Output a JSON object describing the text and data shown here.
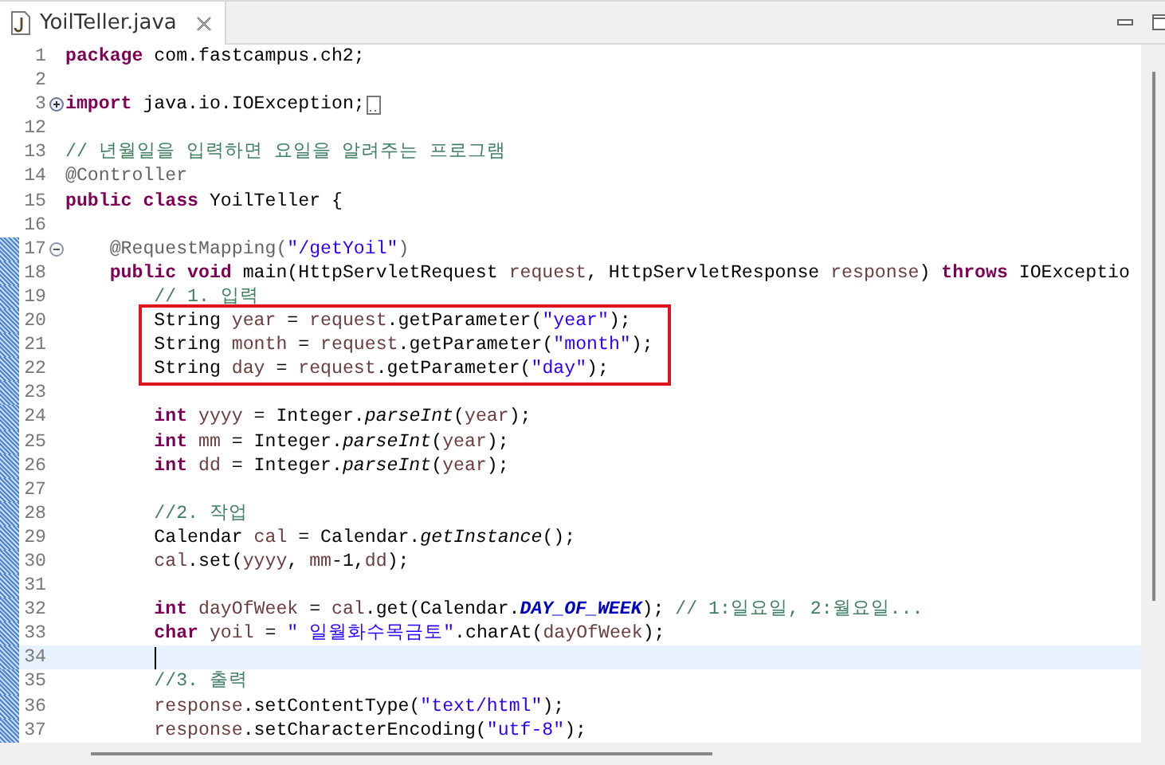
{
  "tab": {
    "title": "YoilTeller.java",
    "selected": true
  },
  "lines": [
    {
      "number": "1",
      "tokens": [
        {
          "kind": "keyword",
          "text": "package"
        },
        {
          "kind": "plain",
          "text": " com.fastcampus.ch2;"
        }
      ]
    },
    {
      "number": "2"
    },
    {
      "number": "3",
      "folded": true,
      "tokens": [
        {
          "kind": "keyword",
          "text": "import"
        },
        {
          "kind": "plain",
          "text": " java.io.IOException;"
        }
      ]
    },
    {
      "number": "12"
    },
    {
      "number": "13",
      "tokens": [
        {
          "kind": "comment",
          "text": "// 년월일을 입력하면 요일을 알려주는 프로그램"
        }
      ]
    },
    {
      "number": "14",
      "tokens": [
        {
          "kind": "annotation",
          "text": "@Controller"
        }
      ]
    },
    {
      "number": "15",
      "tokens": [
        {
          "kind": "keyword",
          "text": "public"
        },
        {
          "kind": "keyword",
          "text": " class"
        },
        {
          "kind": "plain",
          "text": " YoilTeller {"
        }
      ]
    },
    {
      "number": "16"
    },
    {
      "number": "17",
      "folded": false,
      "range": true,
      "tokens": [
        {
          "kind": "annotation",
          "text": "    @RequestMapping("
        },
        {
          "kind": "string",
          "text": "\"/getYoil\""
        },
        {
          "kind": "annotation",
          "text": ")"
        }
      ]
    },
    {
      "number": "18",
      "range": true,
      "tokens": [
        {
          "kind": "keyword",
          "text": "    public"
        },
        {
          "kind": "keyword",
          "text": " void"
        },
        {
          "kind": "plain",
          "text": " main(HttpServletRequest "
        },
        {
          "kind": "variable",
          "text": "request"
        },
        {
          "kind": "plain",
          "text": ", HttpServletResponse "
        },
        {
          "kind": "variable",
          "text": "response"
        },
        {
          "kind": "plain",
          "text": ") "
        },
        {
          "kind": "keyword",
          "text": "throws"
        },
        {
          "kind": "plain",
          "text": " IOExceptio"
        }
      ]
    },
    {
      "number": "19",
      "range": true,
      "tokens": [
        {
          "kind": "comment",
          "text": "        // 1. 입력"
        }
      ]
    },
    {
      "number": "20",
      "range": true,
      "boxed": true,
      "tokens": [
        {
          "kind": "plain",
          "text": "        String "
        },
        {
          "kind": "variable",
          "text": "year"
        },
        {
          "kind": "plain",
          "text": " = "
        },
        {
          "kind": "variable",
          "text": "request"
        },
        {
          "kind": "plain",
          "text": ".getParameter("
        },
        {
          "kind": "string",
          "text": "\"year\""
        },
        {
          "kind": "plain",
          "text": ");"
        }
      ]
    },
    {
      "number": "21",
      "range": true,
      "boxed": true,
      "tokens": [
        {
          "kind": "plain",
          "text": "        String "
        },
        {
          "kind": "variable",
          "text": "month"
        },
        {
          "kind": "plain",
          "text": " = "
        },
        {
          "kind": "variable",
          "text": "request"
        },
        {
          "kind": "plain",
          "text": ".getParameter("
        },
        {
          "kind": "string",
          "text": "\"month\""
        },
        {
          "kind": "plain",
          "text": ");"
        }
      ]
    },
    {
      "number": "22",
      "range": true,
      "boxed": true,
      "tokens": [
        {
          "kind": "plain",
          "text": "        String "
        },
        {
          "kind": "variable",
          "text": "day"
        },
        {
          "kind": "plain",
          "text": " = "
        },
        {
          "kind": "variable",
          "text": "request"
        },
        {
          "kind": "plain",
          "text": ".getParameter("
        },
        {
          "kind": "string",
          "text": "\"day\""
        },
        {
          "kind": "plain",
          "text": ");"
        }
      ]
    },
    {
      "number": "23",
      "range": true
    },
    {
      "number": "24",
      "range": true,
      "tokens": [
        {
          "kind": "keyword",
          "text": "        int"
        },
        {
          "kind": "variable",
          "text": " yyyy"
        },
        {
          "kind": "plain",
          "text": " = Integer."
        },
        {
          "kind": "static",
          "text": "parseInt"
        },
        {
          "kind": "plain",
          "text": "("
        },
        {
          "kind": "variable",
          "text": "year"
        },
        {
          "kind": "plain",
          "text": ");"
        }
      ]
    },
    {
      "number": "25",
      "range": true,
      "tokens": [
        {
          "kind": "keyword",
          "text": "        int"
        },
        {
          "kind": "variable",
          "text": " mm"
        },
        {
          "kind": "plain",
          "text": " = Integer."
        },
        {
          "kind": "static",
          "text": "parseInt"
        },
        {
          "kind": "plain",
          "text": "("
        },
        {
          "kind": "variable",
          "text": "year"
        },
        {
          "kind": "plain",
          "text": ");"
        }
      ]
    },
    {
      "number": "26",
      "range": true,
      "tokens": [
        {
          "kind": "keyword",
          "text": "        int"
        },
        {
          "kind": "variable",
          "text": " dd"
        },
        {
          "kind": "plain",
          "text": " = Integer."
        },
        {
          "kind": "static",
          "text": "parseInt"
        },
        {
          "kind": "plain",
          "text": "("
        },
        {
          "kind": "variable",
          "text": "year"
        },
        {
          "kind": "plain",
          "text": ");"
        }
      ]
    },
    {
      "number": "27",
      "range": true
    },
    {
      "number": "28",
      "range": true,
      "tokens": [
        {
          "kind": "comment",
          "text": "        //2. 작업"
        }
      ]
    },
    {
      "number": "29",
      "range": true,
      "tokens": [
        {
          "kind": "plain",
          "text": "        Calendar "
        },
        {
          "kind": "variable",
          "text": "cal"
        },
        {
          "kind": "plain",
          "text": " = Calendar."
        },
        {
          "kind": "static",
          "text": "getInstance"
        },
        {
          "kind": "plain",
          "text": "();"
        }
      ]
    },
    {
      "number": "30",
      "range": true,
      "tokens": [
        {
          "kind": "variable",
          "text": "        cal"
        },
        {
          "kind": "plain",
          "text": ".set("
        },
        {
          "kind": "variable",
          "text": "yyyy"
        },
        {
          "kind": "plain",
          "text": ", "
        },
        {
          "kind": "variable",
          "text": "mm"
        },
        {
          "kind": "plain",
          "text": "-1,"
        },
        {
          "kind": "variable",
          "text": "dd"
        },
        {
          "kind": "plain",
          "text": ");"
        }
      ]
    },
    {
      "number": "31",
      "range": true
    },
    {
      "number": "32",
      "range": true,
      "tokens": [
        {
          "kind": "keyword",
          "text": "        int"
        },
        {
          "kind": "variable",
          "text": " dayOfWeek"
        },
        {
          "kind": "plain",
          "text": " = "
        },
        {
          "kind": "variable",
          "text": "cal"
        },
        {
          "kind": "plain",
          "text": ".get(Calendar."
        },
        {
          "kind": "constant",
          "text": "DAY_OF_WEEK"
        },
        {
          "kind": "plain",
          "text": "); "
        },
        {
          "kind": "comment",
          "text": "// 1:일요일, 2:월요일..."
        }
      ]
    },
    {
      "number": "33",
      "range": true,
      "tokens": [
        {
          "kind": "keyword",
          "text": "        char"
        },
        {
          "kind": "variable",
          "text": " yoil"
        },
        {
          "kind": "plain",
          "text": " = "
        },
        {
          "kind": "string",
          "text": "\" 일월화수목금토\""
        },
        {
          "kind": "plain",
          "text": ".charAt("
        },
        {
          "kind": "variable",
          "text": "dayOfWeek"
        },
        {
          "kind": "plain",
          "text": ");"
        }
      ]
    },
    {
      "number": "34",
      "range": true,
      "current": true
    },
    {
      "number": "35",
      "range": true,
      "tokens": [
        {
          "kind": "comment",
          "text": "        //3. 출력"
        }
      ]
    },
    {
      "number": "36",
      "range": true,
      "tokens": [
        {
          "kind": "variable",
          "text": "        response"
        },
        {
          "kind": "plain",
          "text": ".setContentType("
        },
        {
          "kind": "string",
          "text": "\"text/html\""
        },
        {
          "kind": "plain",
          "text": ");"
        }
      ]
    },
    {
      "number": "37",
      "range": true,
      "tokens": [
        {
          "kind": "variable",
          "text": "        response"
        },
        {
          "kind": "plain",
          "text": ".setCharacterEncoding("
        },
        {
          "kind": "string",
          "text": "\"utf-8\""
        },
        {
          "kind": "plain",
          "text": ");"
        }
      ]
    }
  ]
}
